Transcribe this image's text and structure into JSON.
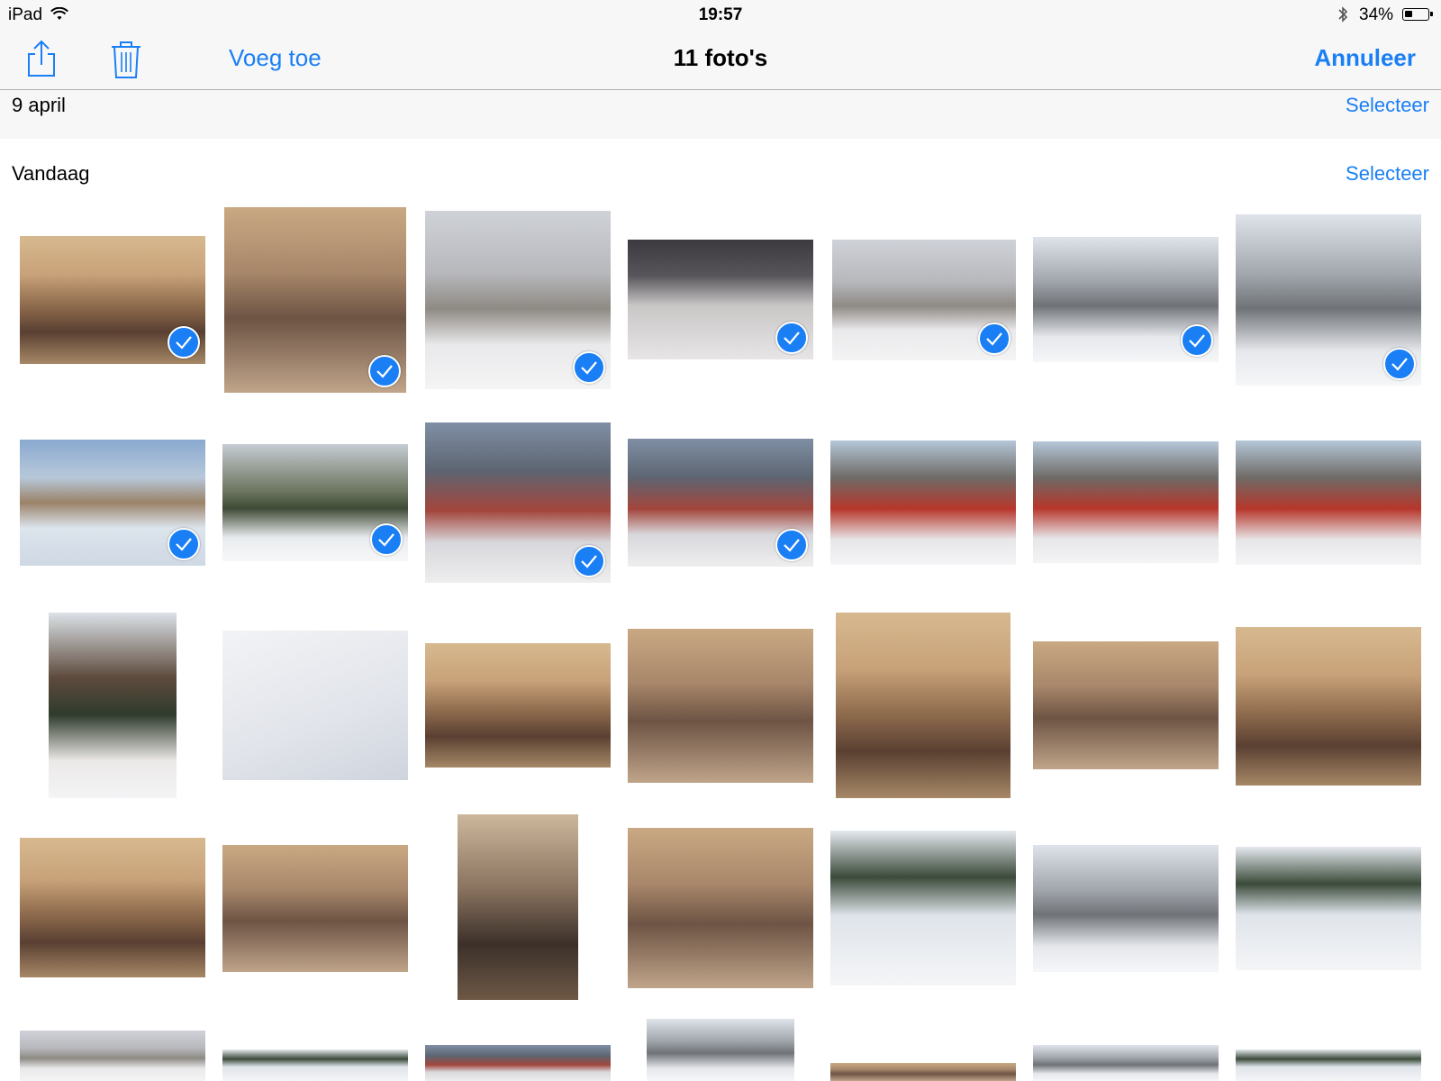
{
  "status_bar": {
    "device": "iPad",
    "time": "19:57",
    "battery_percent": "34%",
    "battery_level": 0.34,
    "icons": [
      "wifi-icon",
      "bluetooth-icon",
      "battery-icon"
    ]
  },
  "nav": {
    "share_icon": "share-icon",
    "trash_icon": "trash-icon",
    "add_label": "Voeg toe",
    "title": "11 foto's",
    "cancel_label": "Annuleer"
  },
  "sections": {
    "previous": {
      "title": "9 april",
      "select_label": "Selecteer"
    },
    "current": {
      "title": "Vandaag",
      "select_label": "Selecteer"
    }
  },
  "colors": {
    "accent": "#1a7ff5",
    "bar_background": "#f7f7f7"
  },
  "selected_photo_count": 11,
  "photo_grid_rows": [
    [
      "selected",
      "selected",
      "selected",
      "selected",
      "selected",
      "selected",
      "selected"
    ],
    [
      "selected",
      "selected",
      "selected",
      "selected",
      "unselected",
      "unselected",
      "unselected"
    ],
    [
      "unselected",
      "unselected",
      "unselected",
      "unselected",
      "unselected",
      "unselected",
      "unselected"
    ],
    [
      "unselected",
      "unselected",
      "unselected",
      "unselected",
      "unselected",
      "unselected",
      "unselected"
    ],
    [
      "unselected",
      "unselected",
      "unselected",
      "unselected",
      "unselected",
      "unselected",
      "unselected"
    ]
  ]
}
